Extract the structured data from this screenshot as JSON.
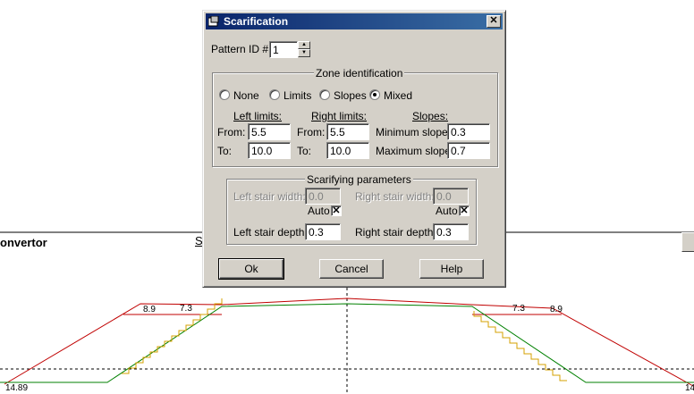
{
  "background": {
    "app_title_fragment": "onvertor",
    "underlined_fragment": "S",
    "profile_labels": {
      "left_station": "14.89",
      "right_station": "14",
      "left_outer": "8.9",
      "left_inner": "7.3",
      "right_inner": "7.3",
      "right_outer": "8.9"
    }
  },
  "dialog": {
    "title": "Scarification",
    "pattern_id_label": "Pattern ID #",
    "pattern_id_value": "1",
    "zone": {
      "title": "Zone identification",
      "options": [
        {
          "label": "None",
          "selected": false
        },
        {
          "label": "Limits",
          "selected": false
        },
        {
          "label": "Slopes",
          "selected": false
        },
        {
          "label": "Mixed",
          "selected": true
        }
      ],
      "left_limits_title": "Left limits:",
      "right_limits_title": "Right limits:",
      "slopes_title": "Slopes:",
      "from_label": "From:",
      "to_label": "To:",
      "left_from": "5.5",
      "left_to": "10.0",
      "right_from": "5.5",
      "right_to": "10.0",
      "min_slope_label": "Minimum slope:",
      "max_slope_label": "Maximum slope:",
      "min_slope": "0.3",
      "max_slope": "0.7"
    },
    "scarifying": {
      "title": "Scarifying parameters",
      "left_stair_width_label": "Left stair width:",
      "left_stair_width": "0.0",
      "right_stair_width_label": "Right stair width:",
      "right_stair_width": "0.0",
      "auto_label": "Auto",
      "left_auto_checked": true,
      "right_auto_checked": true,
      "left_stair_depth_label": "Left stair depth:",
      "left_stair_depth": "0.3",
      "right_stair_depth_label": "Right stair depth:",
      "right_stair_depth": "0.3"
    },
    "buttons": {
      "ok": "Ok",
      "cancel": "Cancel",
      "help": "Help"
    }
  },
  "colors": {
    "title_bar": "#0a246a",
    "dialog_face": "#d4d0c8",
    "profile_red": "#c00000",
    "profile_green": "#008000",
    "stair_orange": "#d4a000"
  }
}
